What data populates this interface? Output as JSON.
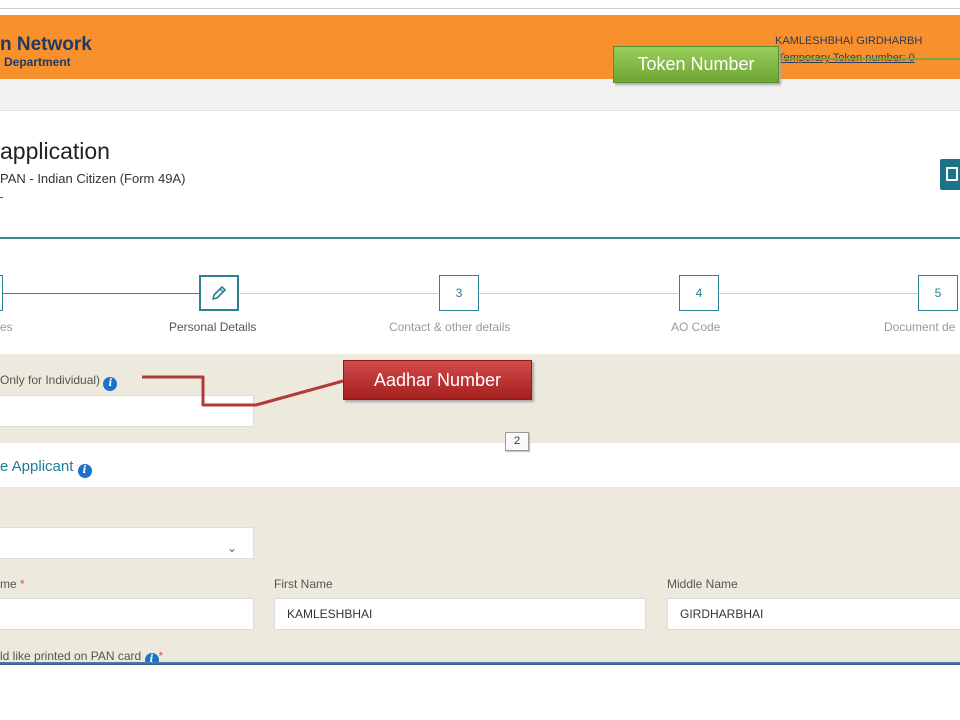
{
  "header": {
    "brand_title": "n Network",
    "brand_subtitle": " Department",
    "user_name": "KAMLESHBHAI GIRDHARBH",
    "token_line": "Temporary Token number: 0"
  },
  "application": {
    "title": "application",
    "subtitle": "PAN - Indian Citizen (Form 49A)",
    "dash": "-"
  },
  "stepper": {
    "steps": [
      {
        "number": "",
        "label": "es",
        "state": "done"
      },
      {
        "number": "",
        "label": "Personal Details",
        "state": "active"
      },
      {
        "number": "3",
        "label": "Contact & other details",
        "state": "pending"
      },
      {
        "number": "4",
        "label": "AO Code",
        "state": "pending"
      },
      {
        "number": "5",
        "label": "Document de",
        "state": "pending"
      }
    ]
  },
  "aadhaar_section": {
    "label": "Only for Individual)",
    "value": ""
  },
  "applicant_section": {
    "heading": "e Applicant"
  },
  "form": {
    "title_select": {
      "value": ""
    },
    "last_name": {
      "label": "me",
      "required": "*",
      "value": ""
    },
    "first_name": {
      "label": "First Name",
      "value": "KAMLESHBHAI"
    },
    "middle_name": {
      "label": "Middle Name",
      "value": "GIRDHARBHAI"
    },
    "print_name_label": "ld like printed on PAN card",
    "print_name_required": "*"
  },
  "annotations": {
    "token_callout": "Token Number",
    "aadhar_callout": "Aadhar Number",
    "page_badge": "2"
  },
  "icons": {
    "info": "info-icon",
    "edit": "pencil-icon",
    "save": "save-icon",
    "dropdown": "chevron-down-icon"
  },
  "colors": {
    "header_orange": "#f7902d",
    "teal": "#2a7f93",
    "beige": "#ede9dc",
    "token_green": "#7ba23c",
    "aadhar_red": "#b52a2a"
  }
}
